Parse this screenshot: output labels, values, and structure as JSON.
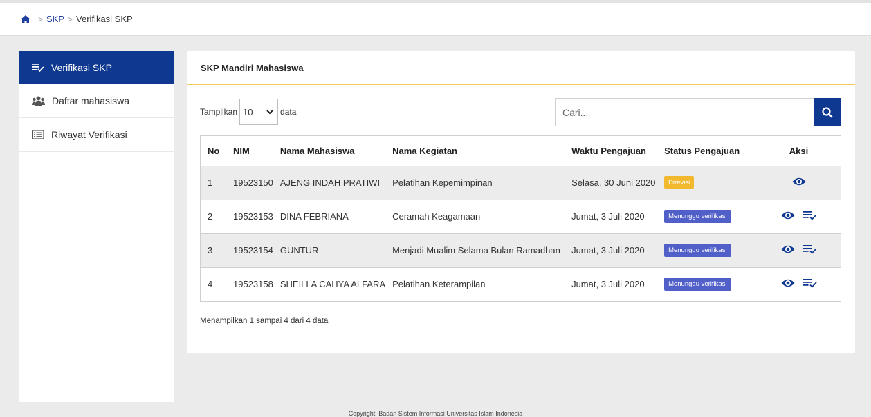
{
  "breadcrumb": {
    "home_icon": "home-icon",
    "link": "SKP",
    "current": "Verifikasi SKP",
    "separator": ">"
  },
  "sidebar": {
    "items": [
      {
        "label": "Verifikasi SKP",
        "icon": "list-check-icon",
        "active": true
      },
      {
        "label": "Daftar mahasiswa",
        "icon": "users-icon",
        "active": false
      },
      {
        "label": "Riwayat Verifikasi",
        "icon": "list-alt-icon",
        "active": false
      }
    ]
  },
  "panel": {
    "title": "SKP Mandiri Mahasiswa",
    "show_prefix": "Tampilkan",
    "show_value": "10",
    "show_suffix": "data",
    "search_placeholder": "Cari...",
    "table": {
      "headers": [
        "No",
        "NIM",
        "Nama Mahasiswa",
        "Nama Kegiatan",
        "Waktu Pengajuan",
        "Status Pengajuan",
        "Aksi"
      ],
      "rows": [
        {
          "no": "1",
          "nim": "19523150",
          "nama": "AJENG INDAH PRATIWI",
          "kegiatan": "Pelatihan Kepemimpinan",
          "waktu": "Selasa, 30 Juni 2020",
          "status": "Direvisi"
        },
        {
          "no": "2",
          "nim": "19523153",
          "nama": "DINA FEBRIANA",
          "kegiatan": "Ceramah Keagamaan",
          "waktu": "Jumat, 3 Juli 2020",
          "status": "Menunggu verifikasi"
        },
        {
          "no": "3",
          "nim": "19523154",
          "nama": "GUNTUR",
          "kegiatan": "Menjadi Mualim Selama Bulan Ramadhan",
          "waktu": "Jumat, 3 Juli 2020",
          "status": "Menunggu verifikasi"
        },
        {
          "no": "4",
          "nim": "19523158",
          "nama": "SHEILLA CAHYA ALFARA",
          "kegiatan": "Pelatihan Keterampilan",
          "waktu": "Jumat, 3 Juli 2020",
          "status": "Menunggu verifikasi"
        }
      ]
    },
    "info": "Menampilkan 1 sampai 4 dari 4 data"
  },
  "footer": "Copyright: Badan Sistem Informasi Universitas Islam Indonesia",
  "colors": {
    "primary": "#0f3891",
    "accent_line": "#f0c95b",
    "badge_revised": "#f2b92e",
    "badge_waiting": "#5160c9"
  }
}
